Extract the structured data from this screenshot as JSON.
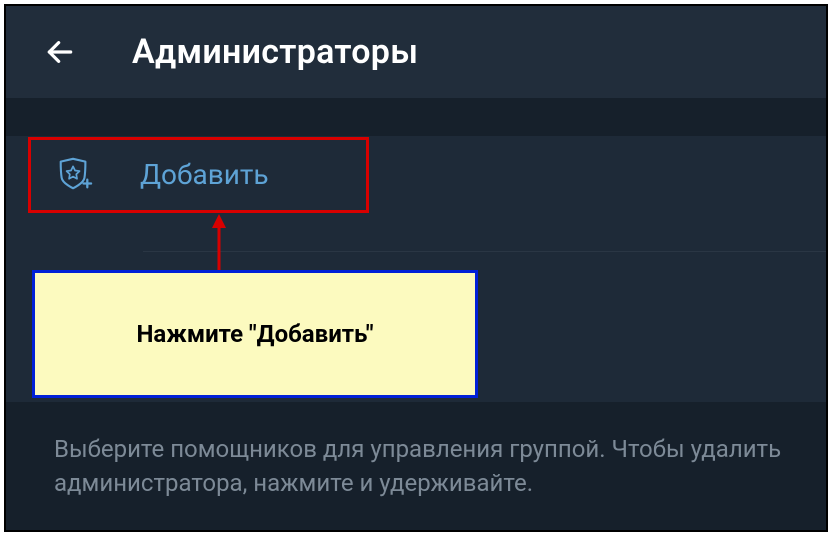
{
  "header": {
    "title": "Администраторы"
  },
  "actions": {
    "add_label": "Добавить"
  },
  "callout": {
    "text": "Нажмите \"Добавить\""
  },
  "help": {
    "text": "Выберите помощников для управления группой. Чтобы удалить администратора, нажмите и удерживайте."
  },
  "colors": {
    "bg_dark": "#16202b",
    "bg_panel": "#1e2a38",
    "bg_header": "#212d3b",
    "accent_link": "#5ea3d6",
    "text_muted": "#7d8a97",
    "highlight_red": "#d80000",
    "highlight_blue": "#0020d8",
    "callout_bg": "#fcfabf"
  }
}
